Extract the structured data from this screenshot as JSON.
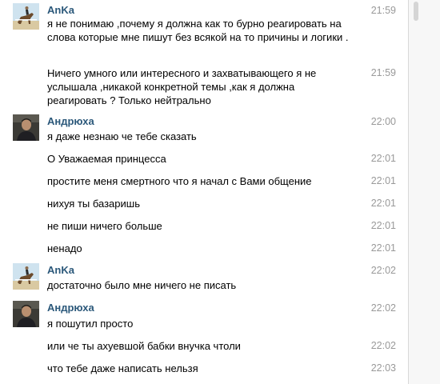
{
  "messages": [
    {
      "author": "AnKa",
      "avatar_icon": "horse-rider-avatar",
      "text": "я не понимаю ,почему я должна как то бурно реагировать на слова которые мне пишут без всякой на то причины и логики .",
      "time": "21:59"
    },
    {
      "text": "Ничего умного или интересного и захватывающего я не услышала ,никакой конкретной темы ,как я должна реагировать ? Только нейтрально",
      "time": "21:59"
    },
    {
      "author": "Андрюха",
      "avatar_icon": "man-photo-avatar",
      "text": "я даже незнаю че тебе сказать",
      "time": "22:00"
    },
    {
      "text": "О Уважаемая принцесса",
      "time": "22:01"
    },
    {
      "text": "простите меня смертного что я начал с Вами общение",
      "time": "22:01"
    },
    {
      "text": "нихуя ты базаришь",
      "time": "22:01"
    },
    {
      "text": "не пиши ничего больше",
      "time": "22:01"
    },
    {
      "text": "ненадо",
      "time": "22:01"
    },
    {
      "author": "AnKa",
      "avatar_icon": "horse-rider-avatar",
      "text": "достаточно было мне ничего не писать",
      "time": "22:02"
    },
    {
      "author": "Андрюха",
      "avatar_icon": "man-photo-avatar",
      "text": "я пошутил просто",
      "time": "22:02"
    },
    {
      "text": "или че ты ахуевшой бабки внучка чтоли",
      "time": "22:02"
    },
    {
      "text": "что тебе даже написать нельзя",
      "time": "22:03"
    }
  ],
  "colors": {
    "author": "#2b587a",
    "time": "#999999",
    "text": "#000000"
  }
}
